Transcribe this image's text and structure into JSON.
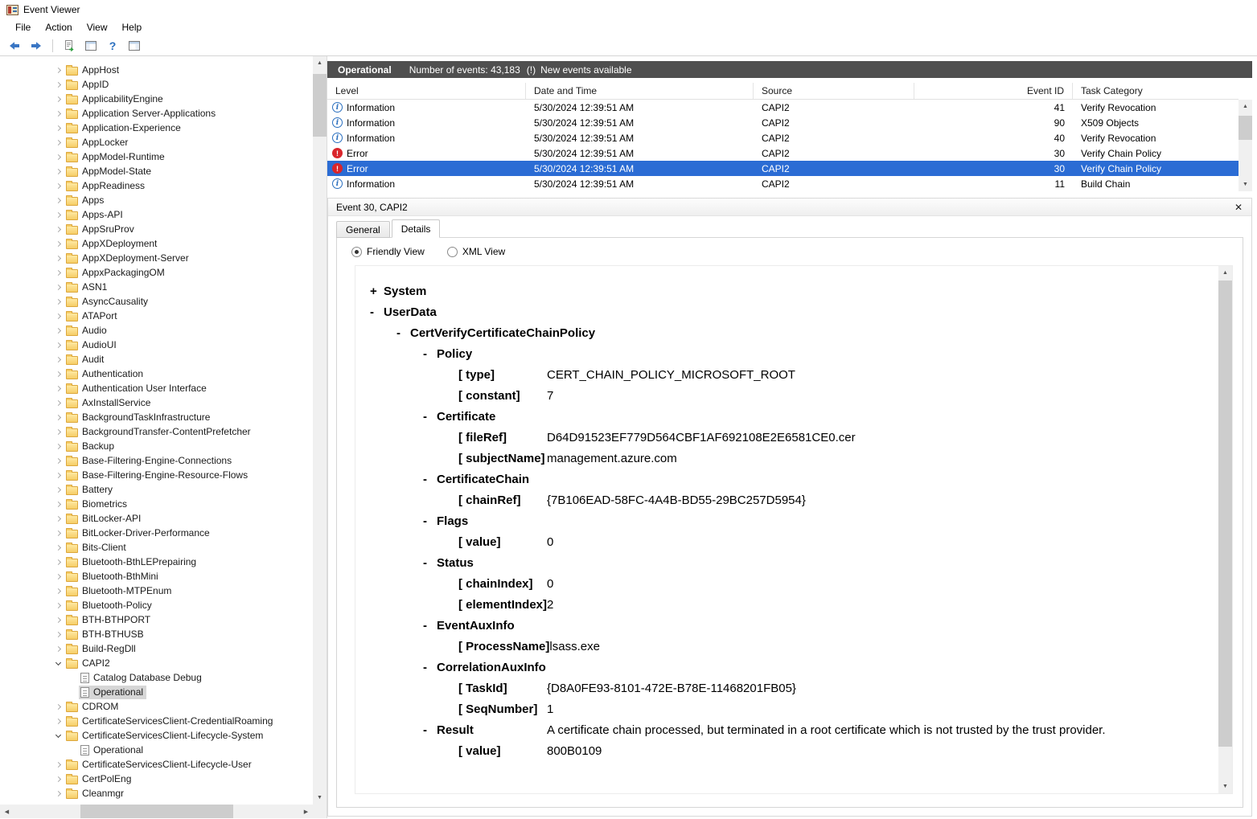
{
  "colors": {
    "selection": "#2b6cd4",
    "banner_bg": "#4f4f4f",
    "error_red": "#d9252b",
    "info_blue": "#2a6fbf"
  },
  "titlebar": {
    "title": "Event Viewer"
  },
  "menubar": {
    "items": [
      "File",
      "Action",
      "View",
      "Help"
    ]
  },
  "toolbar": {
    "help_glyph": "?"
  },
  "tree": {
    "items": [
      {
        "label": "AppHost"
      },
      {
        "label": "AppID"
      },
      {
        "label": "ApplicabilityEngine"
      },
      {
        "label": "Application Server-Applications"
      },
      {
        "label": "Application-Experience"
      },
      {
        "label": "AppLocker"
      },
      {
        "label": "AppModel-Runtime"
      },
      {
        "label": "AppModel-State"
      },
      {
        "label": "AppReadiness"
      },
      {
        "label": "Apps"
      },
      {
        "label": "Apps-API"
      },
      {
        "label": "AppSruProv"
      },
      {
        "label": "AppXDeployment"
      },
      {
        "label": "AppXDeployment-Server"
      },
      {
        "label": "AppxPackagingOM"
      },
      {
        "label": "ASN1"
      },
      {
        "label": "AsyncCausality"
      },
      {
        "label": "ATAPort"
      },
      {
        "label": "Audio"
      },
      {
        "label": "AudioUI"
      },
      {
        "label": "Audit"
      },
      {
        "label": "Authentication"
      },
      {
        "label": "Authentication User Interface"
      },
      {
        "label": "AxInstallService"
      },
      {
        "label": "BackgroundTaskInfrastructure"
      },
      {
        "label": "BackgroundTransfer-ContentPrefetcher"
      },
      {
        "label": "Backup"
      },
      {
        "label": "Base-Filtering-Engine-Connections"
      },
      {
        "label": "Base-Filtering-Engine-Resource-Flows"
      },
      {
        "label": "Battery"
      },
      {
        "label": "Biometrics"
      },
      {
        "label": "BitLocker-API"
      },
      {
        "label": "BitLocker-Driver-Performance"
      },
      {
        "label": "Bits-Client"
      },
      {
        "label": "Bluetooth-BthLEPrepairing"
      },
      {
        "label": "Bluetooth-BthMini"
      },
      {
        "label": "Bluetooth-MTPEnum"
      },
      {
        "label": "Bluetooth-Policy"
      },
      {
        "label": "BTH-BTHPORT"
      },
      {
        "label": "BTH-BTHUSB"
      },
      {
        "label": "Build-RegDll"
      },
      {
        "label": "CAPI2",
        "state": "expanded"
      },
      {
        "label": "Catalog Database Debug",
        "icon": "log",
        "level": 2
      },
      {
        "label": "Operational",
        "icon": "log",
        "level": 2,
        "selected": true
      },
      {
        "label": "CDROM"
      },
      {
        "label": "CertificateServicesClient-CredentialRoaming"
      },
      {
        "label": "CertificateServicesClient-Lifecycle-System",
        "state": "expanded"
      },
      {
        "label": "Operational",
        "icon": "log",
        "level": 2
      },
      {
        "label": "CertificateServicesClient-Lifecycle-User"
      },
      {
        "label": "CertPolEng"
      },
      {
        "label": "Cleanmgr"
      }
    ]
  },
  "banner": {
    "title": "Operational",
    "count_text": "Number of events: 43,183",
    "alert_glyph": "(!)",
    "alert_text": "New events available"
  },
  "events": {
    "columns": [
      "Level",
      "Date and Time",
      "Source",
      "Event ID",
      "Task Category"
    ],
    "rows": [
      {
        "icon": "info",
        "level": "Information",
        "datetime": "5/30/2024 12:39:51 AM",
        "source": "CAPI2",
        "event_id": "41",
        "task": "Verify Revocation"
      },
      {
        "icon": "info",
        "level": "Information",
        "datetime": "5/30/2024 12:39:51 AM",
        "source": "CAPI2",
        "event_id": "90",
        "task": "X509 Objects"
      },
      {
        "icon": "info",
        "level": "Information",
        "datetime": "5/30/2024 12:39:51 AM",
        "source": "CAPI2",
        "event_id": "40",
        "task": "Verify Revocation"
      },
      {
        "icon": "error",
        "level": "Error",
        "datetime": "5/30/2024 12:39:51 AM",
        "source": "CAPI2",
        "event_id": "30",
        "task": "Verify Chain Policy"
      },
      {
        "icon": "error",
        "level": "Error",
        "datetime": "5/30/2024 12:39:51 AM",
        "source": "CAPI2",
        "event_id": "30",
        "task": "Verify Chain Policy",
        "selected": true
      },
      {
        "icon": "info",
        "level": "Information",
        "datetime": "5/30/2024 12:39:51 AM",
        "source": "CAPI2",
        "event_id": "11",
        "task": "Build Chain"
      }
    ]
  },
  "detail": {
    "title": "Event 30, CAPI2",
    "tabs": {
      "general": "General",
      "details": "Details"
    },
    "views": {
      "friendly": "Friendly View",
      "xml": "XML View"
    },
    "rows": [
      {
        "kind": "node",
        "indent": 0,
        "expand": "+",
        "label": "System"
      },
      {
        "kind": "node",
        "indent": 0,
        "expand": "-",
        "label": "UserData"
      },
      {
        "kind": "node",
        "indent": 1,
        "expand": "-",
        "label": "CertVerifyCertificateChainPolicy"
      },
      {
        "kind": "node",
        "indent": 2,
        "expand": "-",
        "label": "Policy"
      },
      {
        "kind": "kv",
        "key": "type",
        "value": "CERT_CHAIN_POLICY_MICROSOFT_ROOT"
      },
      {
        "kind": "kv",
        "key": "constant",
        "value": "7"
      },
      {
        "kind": "node",
        "indent": 2,
        "expand": "-",
        "label": "Certificate"
      },
      {
        "kind": "kv",
        "key": "fileRef",
        "value": "D64D91523EF779D564CBF1AF692108E2E6581CE0.cer"
      },
      {
        "kind": "kv",
        "key": "subjectName",
        "value": "management.azure.com"
      },
      {
        "kind": "node",
        "indent": 2,
        "expand": "-",
        "label": "CertificateChain"
      },
      {
        "kind": "kv",
        "key": "chainRef",
        "value": "{7B106EAD-58FC-4A4B-BD55-29BC257D5954}"
      },
      {
        "kind": "node",
        "indent": 2,
        "expand": "-",
        "label": "Flags"
      },
      {
        "kind": "kv",
        "key": "value",
        "value": "0"
      },
      {
        "kind": "node",
        "indent": 2,
        "expand": "-",
        "label": "Status"
      },
      {
        "kind": "kv",
        "key": "chainIndex",
        "value": "0"
      },
      {
        "kind": "kv",
        "key": "elementIndex",
        "value": "2"
      },
      {
        "kind": "node",
        "indent": 2,
        "expand": "-",
        "label": "EventAuxInfo"
      },
      {
        "kind": "kv",
        "key": "ProcessName",
        "value": "lsass.exe"
      },
      {
        "kind": "node",
        "indent": 2,
        "expand": "-",
        "label": "CorrelationAuxInfo"
      },
      {
        "kind": "kv",
        "key": "TaskId",
        "value": "{D8A0FE93-8101-472E-B78E-11468201FB05}"
      },
      {
        "kind": "kv",
        "key": "SeqNumber",
        "value": "1"
      },
      {
        "kind": "node",
        "indent": 2,
        "expand": "-",
        "label": "Result",
        "value": "A certificate chain processed, but terminated in a root certificate which is not trusted by the trust provider."
      },
      {
        "kind": "kv",
        "key": "value",
        "value": "800B0109"
      }
    ]
  }
}
